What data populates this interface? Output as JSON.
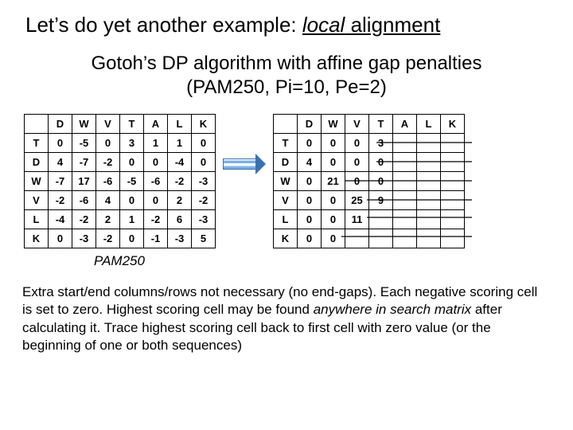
{
  "title": {
    "prefix": "Let’s do yet another example: ",
    "italic_underlined": "local",
    "suffix_underlined": " alignment"
  },
  "subtitle": "Gotoh’s DP algorithm with affine gap penalties (PAM250, Pi=10, Pe=2)",
  "left_table": {
    "col_headers": [
      "",
      "D",
      "W",
      "V",
      "T",
      "A",
      "L",
      "K"
    ],
    "rows": [
      {
        "h": "T",
        "cells": [
          "0",
          "-5",
          "0",
          "3",
          "1",
          "1",
          "0"
        ]
      },
      {
        "h": "D",
        "cells": [
          "4",
          "-7",
          "-2",
          "0",
          "0",
          "-4",
          "0"
        ]
      },
      {
        "h": "W",
        "cells": [
          "-7",
          "17",
          "-6",
          "-5",
          "-6",
          "-2",
          "-3"
        ]
      },
      {
        "h": "V",
        "cells": [
          "-2",
          "-6",
          "4",
          "0",
          "0",
          "2",
          "-2"
        ]
      },
      {
        "h": "L",
        "cells": [
          "-4",
          "-2",
          "2",
          "1",
          "-2",
          "6",
          "-3"
        ]
      },
      {
        "h": "K",
        "cells": [
          "0",
          "-3",
          "-2",
          "0",
          "-1",
          "-3",
          "5"
        ]
      }
    ]
  },
  "right_table": {
    "col_headers": [
      "",
      "D",
      "W",
      "V",
      "T",
      "A",
      "L",
      "K"
    ],
    "rows": [
      {
        "h": "T",
        "cells": [
          "0",
          "0",
          "0",
          "3",
          "",
          "",
          ""
        ]
      },
      {
        "h": "D",
        "cells": [
          "4",
          "0",
          "0",
          "0",
          "",
          "",
          ""
        ]
      },
      {
        "h": "W",
        "cells": [
          "0",
          "21",
          "0",
          "0",
          "",
          "",
          ""
        ]
      },
      {
        "h": "V",
        "cells": [
          "0",
          "0",
          "25",
          "9",
          "",
          "",
          ""
        ]
      },
      {
        "h": "L",
        "cells": [
          "0",
          "0",
          "11",
          "",
          "",
          "",
          ""
        ]
      },
      {
        "h": "K",
        "cells": [
          "0",
          "0",
          "",
          "",
          "",
          "",
          ""
        ]
      }
    ]
  },
  "pam_label": "PAM250",
  "paragraph": {
    "p1": "Extra start/end columns/rows not necessary (no end-gaps). Each negative scoring cell is set to zero. Highest scoring cell may be found ",
    "ital1": "anywhere in search matrix",
    "p2": " after calculating it. Trace highest scoring cell back to first cell with zero value (or the beginning of one or both sequences)"
  }
}
